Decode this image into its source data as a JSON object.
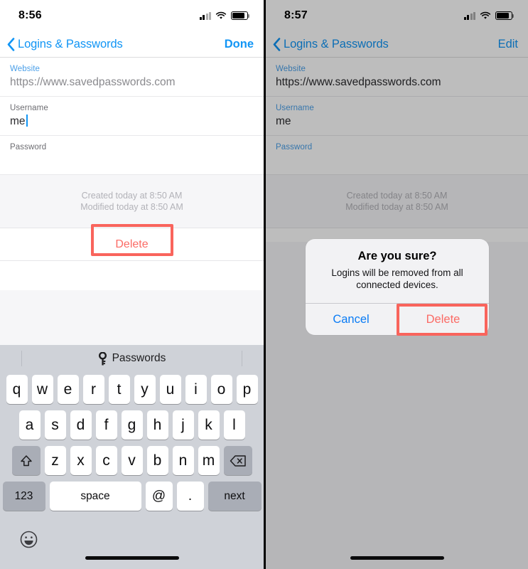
{
  "colors": {
    "accent_blue": "#1195f5",
    "destructive_red": "#fb6b65",
    "annotation_red": "#f9645c",
    "keyboard_bg": "#cfd2d8",
    "label_blue": "#4a9fe8",
    "label_gray": "#6d6d72"
  },
  "left_phone": {
    "status_bar": {
      "time": "8:56",
      "icons": [
        "signal-bars-icon",
        "wifi-icon",
        "battery-icon"
      ]
    },
    "nav_bar": {
      "back_icon": "chevron-left-icon",
      "back_label": "Logins & Passwords",
      "action_label": "Done"
    },
    "form": {
      "fields": [
        {
          "label": "Website",
          "value": "https://www.savedpasswords.com",
          "label_color": "blue",
          "value_state": "placeholderish",
          "caret": false
        },
        {
          "label": "Username",
          "value": "me",
          "label_color": "gray",
          "value_state": "typed",
          "caret": true
        },
        {
          "label": "Password",
          "value": "",
          "label_color": "gray",
          "value_state": "typed",
          "caret": false
        }
      ]
    },
    "meta": {
      "created": "Created today at 8:50 AM",
      "modified": "Modified today at 8:50 AM"
    },
    "delete_row": {
      "label": "Delete",
      "highlighted": true
    },
    "keyboard": {
      "predictive": {
        "icon": "key-icon",
        "label": "Passwords"
      },
      "row1": [
        "q",
        "w",
        "e",
        "r",
        "t",
        "y",
        "u",
        "i",
        "o",
        "p"
      ],
      "row2": [
        "a",
        "s",
        "d",
        "f",
        "g",
        "h",
        "j",
        "k",
        "l"
      ],
      "row3": [
        "z",
        "x",
        "c",
        "v",
        "b",
        "n",
        "m"
      ],
      "shift_icon": "shift-up-arrow-icon",
      "delete_icon": "backspace-icon",
      "row4": {
        "numbers": "123",
        "space": "space",
        "at": "@",
        "dot": ".",
        "next": "next"
      },
      "emoji_icon": "emoji-smiley-icon"
    }
  },
  "right_phone": {
    "status_bar": {
      "time": "8:57",
      "icons": [
        "signal-bars-icon",
        "wifi-icon",
        "battery-icon"
      ]
    },
    "nav_bar": {
      "back_icon": "chevron-left-icon",
      "back_label": "Logins & Passwords",
      "action_label": "Edit"
    },
    "form": {
      "fields": [
        {
          "label": "Website",
          "value": "https://www.savedpasswords.com",
          "label_color": "blue",
          "value_state": "typed",
          "caret": false
        },
        {
          "label": "Username",
          "value": "me",
          "label_color": "blue",
          "value_state": "typed",
          "caret": false
        },
        {
          "label": "Password",
          "value": "",
          "label_color": "blue",
          "value_state": "typed",
          "caret": false
        }
      ]
    },
    "meta": {
      "created": "Created today at 8:50 AM",
      "modified": "Modified today at 8:50 AM"
    },
    "alert": {
      "title": "Are you sure?",
      "message": "Logins will be removed from all connected devices.",
      "cancel_label": "Cancel",
      "delete_label": "Delete",
      "delete_highlighted": true
    }
  }
}
